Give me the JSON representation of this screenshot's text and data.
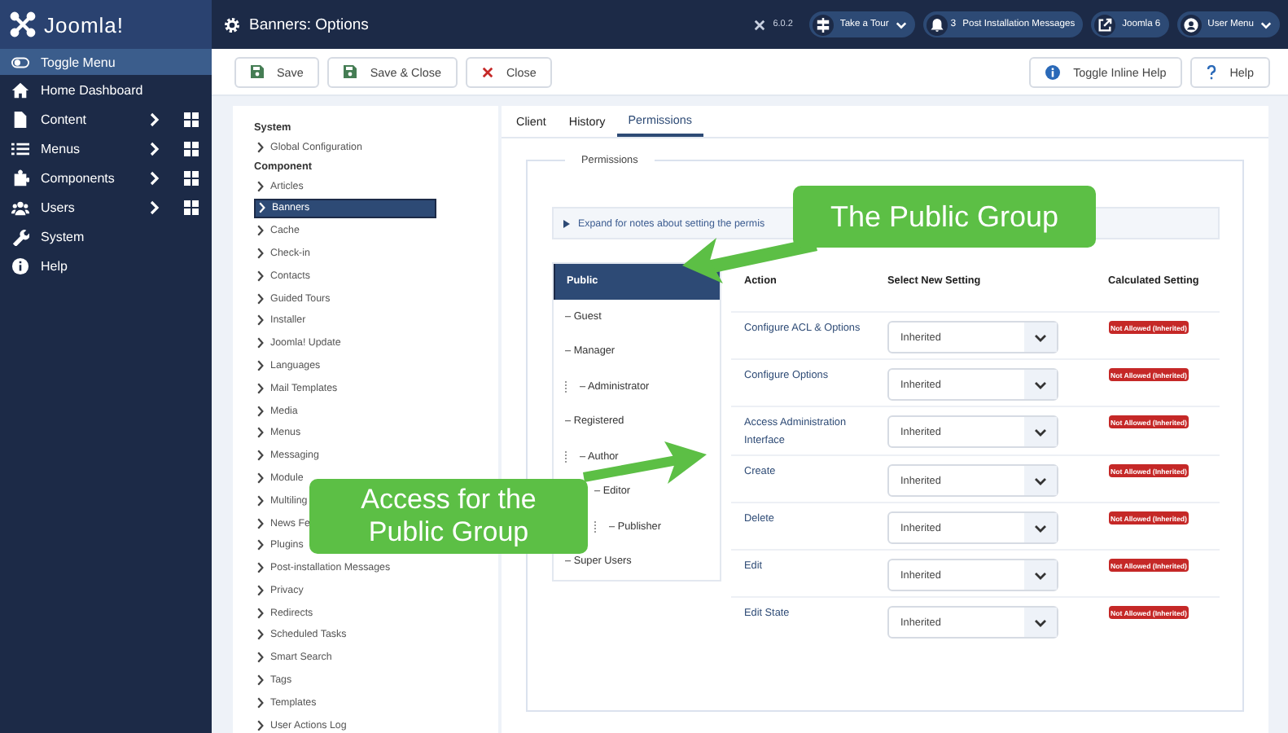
{
  "brand": {
    "name": "Joomla!"
  },
  "header": {
    "title": "Banners: Options",
    "version": "6.0.2",
    "pills": [
      {
        "kind": "tour",
        "label": "Take a Tour"
      },
      {
        "kind": "messages",
        "count": "3",
        "label": "Post Installation Messages"
      },
      {
        "kind": "external",
        "label": "Joomla 6"
      },
      {
        "kind": "user",
        "label": "User Menu"
      }
    ]
  },
  "sidebar": {
    "items": [
      {
        "kind": "toggle",
        "label": "Toggle Menu",
        "selected": true,
        "submenu": false
      },
      {
        "kind": "home",
        "label": "Home Dashboard",
        "selected": false,
        "submenu": false
      },
      {
        "kind": "content",
        "label": "Content",
        "selected": false,
        "submenu": true
      },
      {
        "kind": "menus",
        "label": "Menus",
        "selected": false,
        "submenu": true
      },
      {
        "kind": "components",
        "label": "Components",
        "selected": false,
        "submenu": true
      },
      {
        "kind": "users",
        "label": "Users",
        "selected": false,
        "submenu": true
      },
      {
        "kind": "system",
        "label": "System",
        "selected": false,
        "submenu": false
      },
      {
        "kind": "help",
        "label": "Help",
        "selected": false,
        "submenu": false
      }
    ]
  },
  "toolbar": {
    "left": [
      {
        "kind": "save",
        "label": "Save"
      },
      {
        "kind": "save",
        "label": "Save & Close"
      },
      {
        "kind": "close",
        "label": "Close"
      }
    ],
    "right": [
      {
        "kind": "info",
        "label": "Toggle Inline Help"
      },
      {
        "kind": "help",
        "label": "Help"
      }
    ]
  },
  "options_nav": {
    "sections": [
      {
        "title": "System",
        "items": [
          {
            "label": "Global Configuration",
            "selected": false
          }
        ]
      },
      {
        "title": "Component",
        "items": [
          {
            "label": "Articles",
            "selected": false
          },
          {
            "label": "Banners",
            "selected": true
          },
          {
            "label": "Cache",
            "selected": false
          },
          {
            "label": "Check-in",
            "selected": false
          },
          {
            "label": "Contacts",
            "selected": false
          },
          {
            "label": "Guided Tours",
            "selected": false
          },
          {
            "label": "Installer",
            "selected": false
          },
          {
            "label": "Joomla! Update",
            "selected": false
          },
          {
            "label": "Languages",
            "selected": false
          },
          {
            "label": "Mail Templates",
            "selected": false
          },
          {
            "label": "Media",
            "selected": false
          },
          {
            "label": "Menus",
            "selected": false
          },
          {
            "label": "Messaging",
            "selected": false
          },
          {
            "label": "Module",
            "selected": false
          },
          {
            "label": "Multiling",
            "selected": false
          },
          {
            "label": "News Fe",
            "selected": false
          },
          {
            "label": "Plugins",
            "selected": false
          },
          {
            "label": "Post-installation Messages",
            "selected": false
          },
          {
            "label": "Privacy",
            "selected": false
          },
          {
            "label": "Redirects",
            "selected": false
          },
          {
            "label": "Scheduled Tasks",
            "selected": false
          },
          {
            "label": "Smart Search",
            "selected": false
          },
          {
            "label": "Tags",
            "selected": false
          },
          {
            "label": "Templates",
            "selected": false
          },
          {
            "label": "User Actions Log",
            "selected": false
          }
        ]
      }
    ]
  },
  "tabs": [
    {
      "label": "Client",
      "selected": false
    },
    {
      "label": "History",
      "selected": false
    },
    {
      "label": "Permissions",
      "selected": true
    }
  ],
  "permissions": {
    "legend": "Permissions",
    "notes": "Expand for notes about setting the permis",
    "groups": [
      {
        "label": "Public",
        "selected": true,
        "children": [
          {
            "label": "– Guest",
            "selected": false
          },
          {
            "label": "– Manager",
            "selected": false,
            "children": [
              {
                "label": "– Administrator",
                "selected": false
              }
            ]
          },
          {
            "label": "– Registered",
            "selected": false,
            "children": [
              {
                "label": "– Author",
                "selected": false,
                "children": [
                  {
                    "label": "– Editor",
                    "selected": false,
                    "children": [
                      {
                        "label": "– Publisher",
                        "selected": false
                      }
                    ]
                  }
                ]
              }
            ]
          },
          {
            "label": "– Super Users",
            "selected": false
          }
        ]
      }
    ],
    "columns": [
      "Action",
      "Select New Setting",
      "Calculated Setting"
    ],
    "rows": [
      {
        "action": "Configure ACL & Options",
        "setting": "Inherited",
        "calculated": "Not Allowed (Inherited)"
      },
      {
        "action": "Configure Options",
        "setting": "Inherited",
        "calculated": "Not Allowed (Inherited)"
      },
      {
        "action": "Access Administration Interface",
        "setting": "Inherited",
        "calculated": "Not Allowed (Inherited)"
      },
      {
        "action": "Create",
        "setting": "Inherited",
        "calculated": "Not Allowed (Inherited)"
      },
      {
        "action": "Delete",
        "setting": "Inherited",
        "calculated": "Not Allowed (Inherited)"
      },
      {
        "action": "Edit",
        "setting": "Inherited",
        "calculated": "Not Allowed (Inherited)"
      },
      {
        "action": "Edit State",
        "setting": "Inherited",
        "calculated": "Not Allowed (Inherited)"
      }
    ]
  },
  "callouts": [
    {
      "kind": "top",
      "text": "The Public Group"
    },
    {
      "kind": "bottom",
      "text": "Access for the Public Group"
    }
  ]
}
